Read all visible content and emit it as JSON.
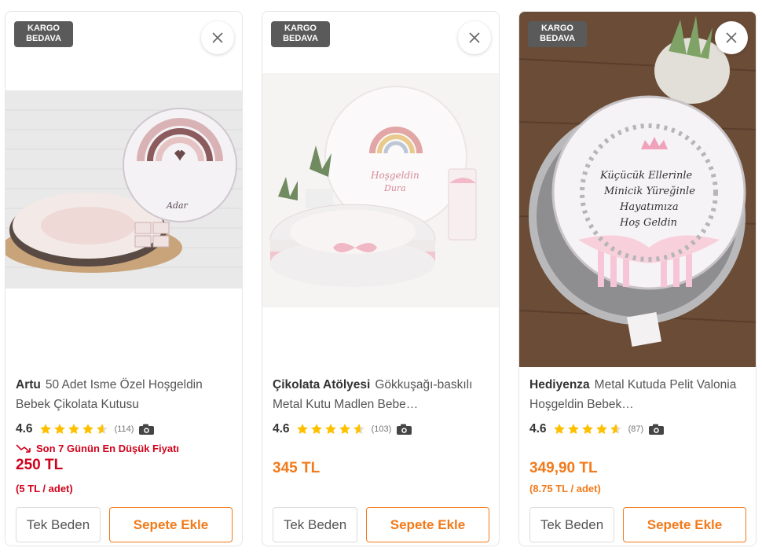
{
  "badge_line1": "KARGO",
  "badge_line2": "BEDAVA",
  "close_icon": "close-icon",
  "colors": {
    "accent": "#f27a1a",
    "star": "#ffc000",
    "discount_red": "#d0021b",
    "price_orange": "#f27a1a",
    "badge_bg": "#5a5a5a"
  },
  "products": [
    {
      "brand": "Artu",
      "name": "50 Adet Isme Özel Hoşgeldin Bebek Çikolata Kutusu",
      "rating": "4.6",
      "rating_value": 4.6,
      "review_count": "(114)",
      "lowest_price_note": "Son 7 Günün En Düşük Fiyatı",
      "price": "250 TL",
      "unit_price": "(5 TL / adet)",
      "size_label": "Tek Beden",
      "cart_label": "Sepete Ekle",
      "image_text_top": "",
      "image_text_bottom": "Adar",
      "price_color": "#d0021b"
    },
    {
      "brand": "Çikolata Atölyesi",
      "name": "Gökkuşağı-baskılı Metal Kutu Madlen Bebe…",
      "rating": "4.6",
      "rating_value": 4.6,
      "review_count": "(103)",
      "price": "345 TL",
      "size_label": "Tek Beden",
      "cart_label": "Sepete Ekle",
      "image_text_top": "Hoşgeldin",
      "image_text_bottom": "Dura",
      "price_color": "#f27a1a"
    },
    {
      "brand": "Hediyenza",
      "name": "Metal Kutuda Pelit Valonia Hoşgeldin Bebek…",
      "rating": "4.6",
      "rating_value": 4.6,
      "review_count": "(87)",
      "price": "349,90 TL",
      "unit_price": "(8.75 TL / adet)",
      "size_label": "Tek Beden",
      "cart_label": "Sepete Ekle",
      "image_lines": [
        "Küçücük Ellerinle",
        "Minicik Yüreğinle",
        "Hayatımıza",
        "Hoş Geldin"
      ],
      "price_color": "#f27a1a"
    }
  ]
}
